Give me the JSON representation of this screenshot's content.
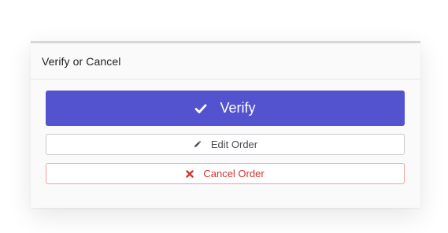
{
  "card": {
    "title": "Verify or Cancel"
  },
  "actions": {
    "verify_label": "Verify",
    "verify_icon": "check-icon",
    "edit_label": "Edit Order",
    "edit_icon": "pencil-icon",
    "cancel_label": "Cancel Order",
    "cancel_icon": "x-icon"
  },
  "colors": {
    "primary": "#5352cf",
    "danger": "#d0342c",
    "danger_border": "#e8a6a1",
    "neutral_border": "#c9c9cf"
  }
}
